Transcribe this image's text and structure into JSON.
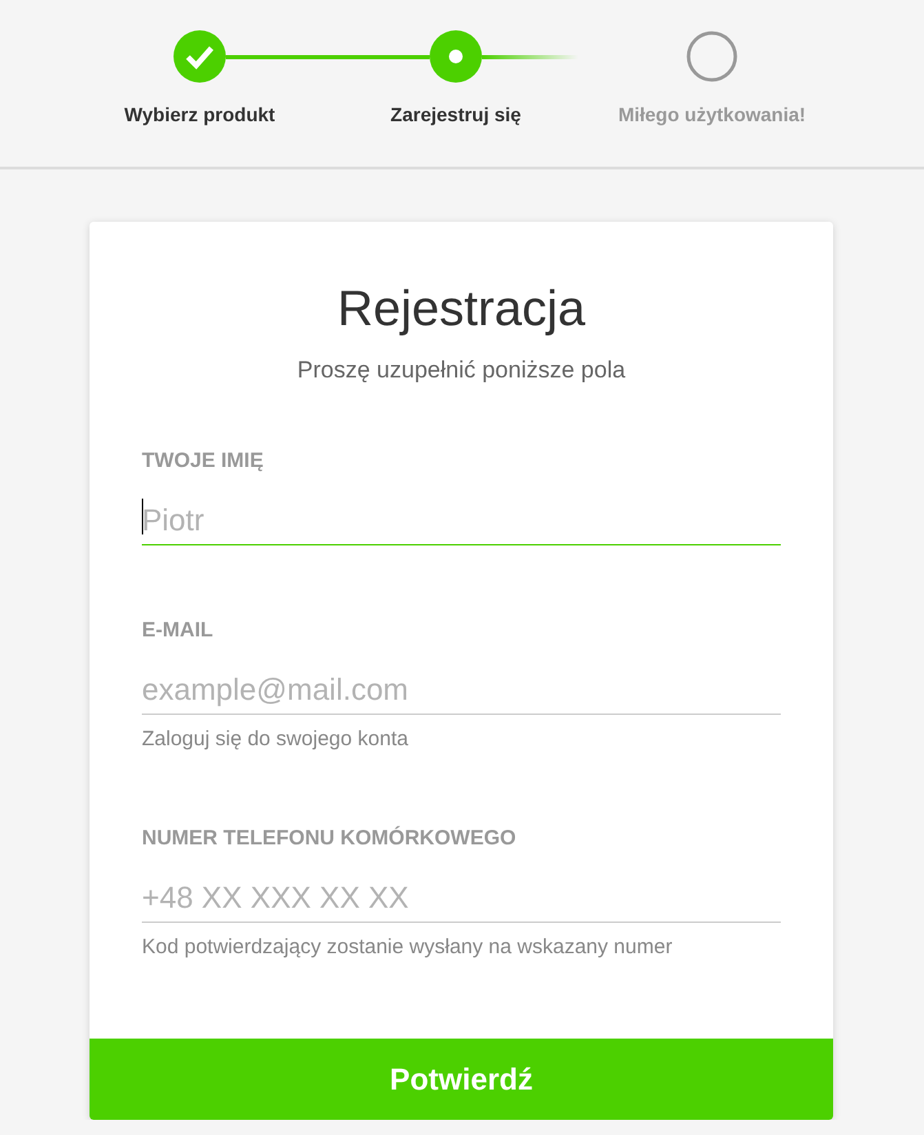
{
  "steps": [
    {
      "label": "Wybierz produkt",
      "kind": "done"
    },
    {
      "label": "Zarejestruj się",
      "kind": "current"
    },
    {
      "label": "Miłego użytkowania!",
      "kind": "pending"
    }
  ],
  "form": {
    "title": "Rejestracja",
    "subtitle": "Proszę uzupełnić poniższe pola",
    "fields": [
      {
        "label": "TWOJE IMIĘ",
        "placeholder": "Piotr",
        "focused": true
      },
      {
        "label": "E-MAIL",
        "placeholder": "example@mail.com",
        "hint": "Zaloguj się do swojego konta",
        "focused": false
      },
      {
        "label": "NUMER TELEFONU KOMÓRKOWEGO",
        "placeholder": "+48 XX XXX XX XX",
        "hint": "Kod potwierdzający zostanie wysłany na wskazany numer",
        "focused": false
      }
    ],
    "submit": "Potwierdź"
  }
}
